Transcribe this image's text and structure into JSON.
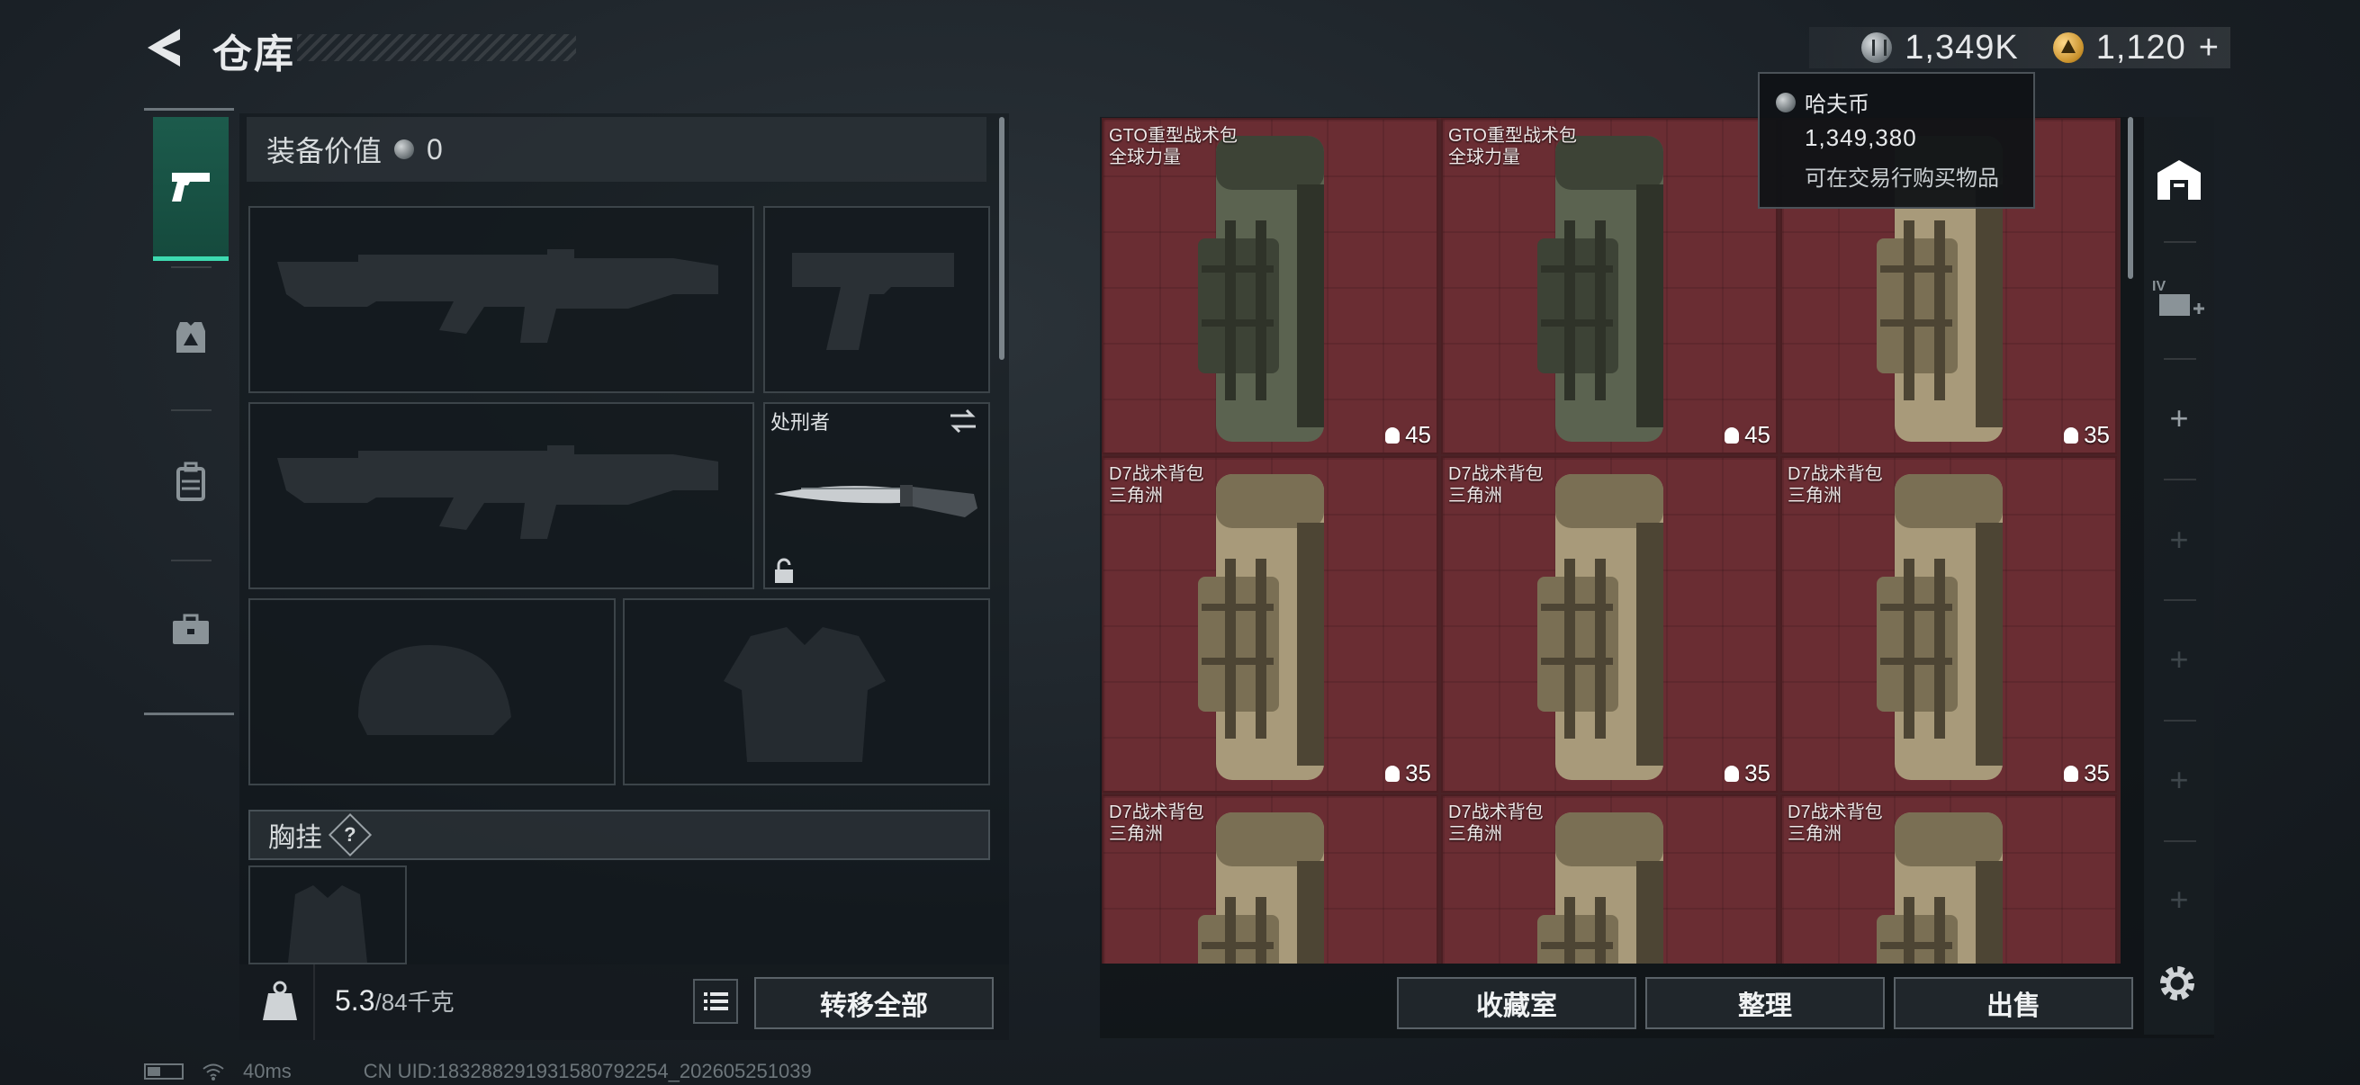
{
  "header": {
    "title": "仓库",
    "coin_amount": "1,349K",
    "token_amount": "1,120",
    "token_add": "+"
  },
  "left_rail": {
    "tabs": [
      {
        "name": "weapons",
        "icon": "pistol-icon",
        "active": true
      },
      {
        "name": "gear",
        "icon": "rig-icon"
      },
      {
        "name": "backpack",
        "icon": "backpack-icon"
      },
      {
        "name": "case",
        "icon": "briefcase-icon"
      }
    ]
  },
  "equipment": {
    "value_label": "装备价值",
    "value": "0",
    "melee_name": "处刑者",
    "chest_label": "胸挂",
    "help": "?"
  },
  "weight": {
    "current": "5.3",
    "max_unit": "/84千克",
    "transfer_all": "转移全部"
  },
  "stash": {
    "items": [
      {
        "name": "GTO重型战术包",
        "sub": "全球力量",
        "count": "45",
        "tone": "green"
      },
      {
        "name": "GTO重型战术包",
        "sub": "全球力量",
        "count": "45",
        "tone": "green"
      },
      {
        "name": "",
        "sub": "",
        "count": "35",
        "tone": "tan"
      },
      {
        "name": "D7战术背包",
        "sub": "三角洲",
        "count": "35",
        "tone": "tan"
      },
      {
        "name": "D7战术背包",
        "sub": "三角洲",
        "count": "35",
        "tone": "tan"
      },
      {
        "name": "D7战术背包",
        "sub": "三角洲",
        "count": "35",
        "tone": "tan"
      },
      {
        "name": "D7战术背包",
        "sub": "三角洲",
        "count": "",
        "tone": "tan"
      },
      {
        "name": "D7战术背包",
        "sub": "三角洲",
        "count": "",
        "tone": "tan"
      },
      {
        "name": "D7战术背包",
        "sub": "三角洲",
        "count": "",
        "tone": "tan"
      }
    ]
  },
  "tooltip": {
    "currency_name": "哈夫币",
    "amount": "1,349,380",
    "description": "可在交易行购买物品"
  },
  "actions": {
    "collection": "收藏室",
    "sort": "整理",
    "sell": "出售"
  },
  "right_rail": {
    "upgrade_level": "IV",
    "add": "+"
  },
  "status_bar": {
    "ping": "40ms",
    "uid": "CN UID:18328829193158079225​4_202605251039"
  },
  "colors": {
    "accent": "#3ddab0",
    "stash_bg": "#6a2d33"
  }
}
